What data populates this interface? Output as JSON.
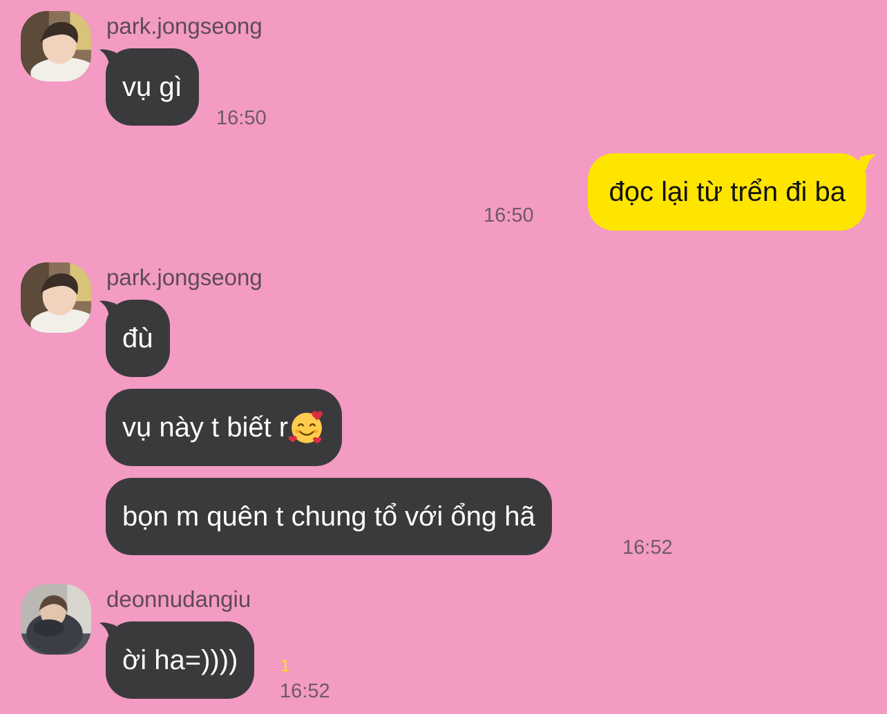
{
  "messages": [
    {
      "sender": "park.jongseong",
      "text": "vụ gì",
      "time": "16:50"
    },
    {
      "sender": "me",
      "text": "đọc lại từ trển đi ba",
      "time": "16:50"
    },
    {
      "sender": "park.jongseong",
      "texts": [
        "đù",
        "vụ này t biết r",
        "bọn m quên t chung tổ với ổng hã"
      ],
      "emoji": "smiling-face-with-hearts-emoji",
      "time": "16:52"
    },
    {
      "sender": "deonnudangiu",
      "text": "ời ha=))))",
      "unread": "1",
      "time": "16:52"
    }
  ],
  "colors": {
    "background": "#f39bc3",
    "incoming_bubble": "#3a3a3c",
    "outgoing_bubble": "#fee500",
    "unread": "#fee500"
  }
}
